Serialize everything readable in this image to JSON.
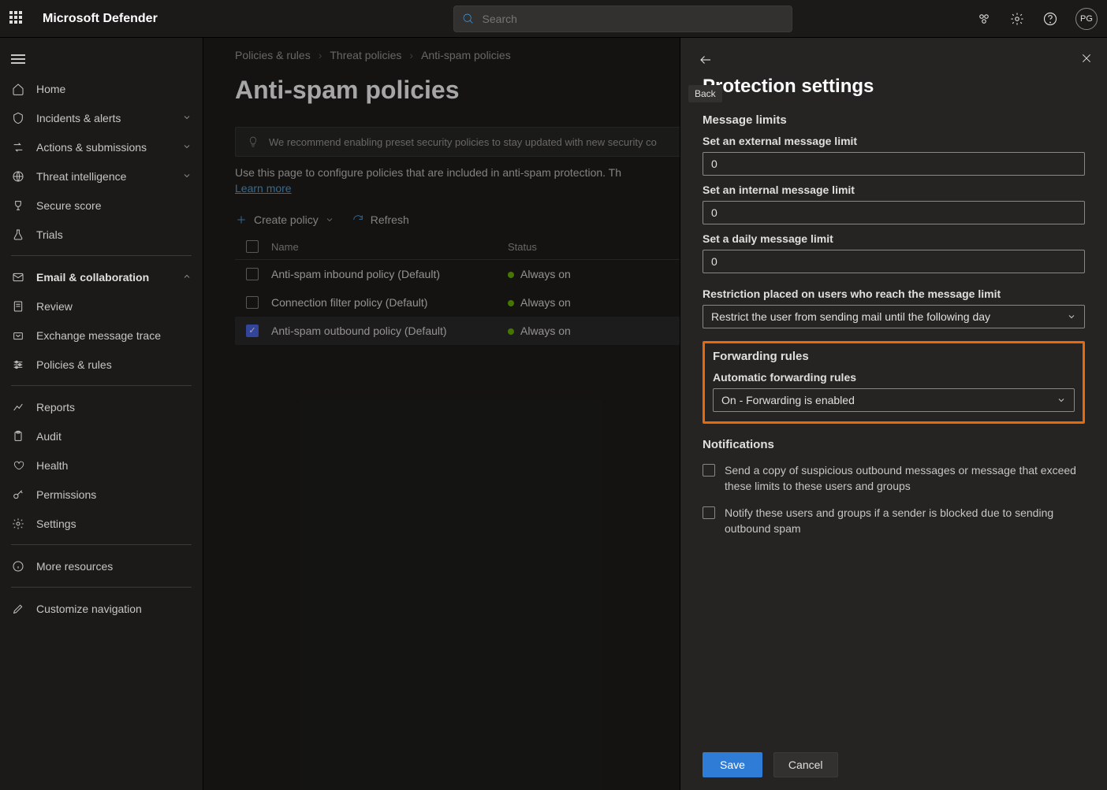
{
  "brand": "Microsoft Defender",
  "search_placeholder": "Search",
  "avatar_initials": "PG",
  "sidebar": {
    "items": [
      {
        "label": "Home"
      },
      {
        "label": "Incidents & alerts",
        "expandable": true
      },
      {
        "label": "Actions & submissions",
        "expandable": true
      },
      {
        "label": "Threat intelligence",
        "expandable": true
      },
      {
        "label": "Secure score"
      },
      {
        "label": "Trials"
      }
    ],
    "section_label": "Email & collaboration",
    "section_items": [
      {
        "label": "Review"
      },
      {
        "label": "Exchange message trace"
      },
      {
        "label": "Policies & rules"
      }
    ],
    "lower_items": [
      {
        "label": "Reports"
      },
      {
        "label": "Audit"
      },
      {
        "label": "Health"
      },
      {
        "label": "Permissions"
      },
      {
        "label": "Settings"
      }
    ],
    "more_label": "More resources",
    "customize_label": "Customize navigation"
  },
  "breadcrumbs": [
    "Policies & rules",
    "Threat policies",
    "Anti-spam policies"
  ],
  "page_title": "Anti-spam policies",
  "banner_text": "We recommend enabling preset security policies to stay updated with new security co",
  "page_desc": "Use this page to configure policies that are included in anti-spam protection. Th",
  "learn_more": "Learn more",
  "toolbar": {
    "create": "Create policy",
    "refresh": "Refresh"
  },
  "table": {
    "headers": {
      "name": "Name",
      "status": "Status"
    },
    "rows": [
      {
        "name": "Anti-spam inbound policy (Default)",
        "status": "Always on",
        "checked": false
      },
      {
        "name": "Connection filter policy (Default)",
        "status": "Always on",
        "checked": false
      },
      {
        "name": "Anti-spam outbound policy (Default)",
        "status": "Always on",
        "checked": true
      }
    ]
  },
  "panel": {
    "tooltip": "Back",
    "title": "Protection settings",
    "msg_limits_head": "Message limits",
    "ext_label": "Set an external message limit",
    "ext_val": "0",
    "int_label": "Set an internal message limit",
    "int_val": "0",
    "daily_label": "Set a daily message limit",
    "daily_val": "0",
    "restrict_label": "Restriction placed on users who reach the message limit",
    "restrict_val": "Restrict the user from sending mail until the following day",
    "fwd_head": "Forwarding rules",
    "fwd_label": "Automatic forwarding rules",
    "fwd_val": "On - Forwarding is enabled",
    "notif_head": "Notifications",
    "notif1": "Send a copy of suspicious outbound messages or message that exceed these limits to these users and groups",
    "notif2": "Notify these users and groups if a sender is blocked due to sending outbound spam",
    "save": "Save",
    "cancel": "Cancel"
  }
}
